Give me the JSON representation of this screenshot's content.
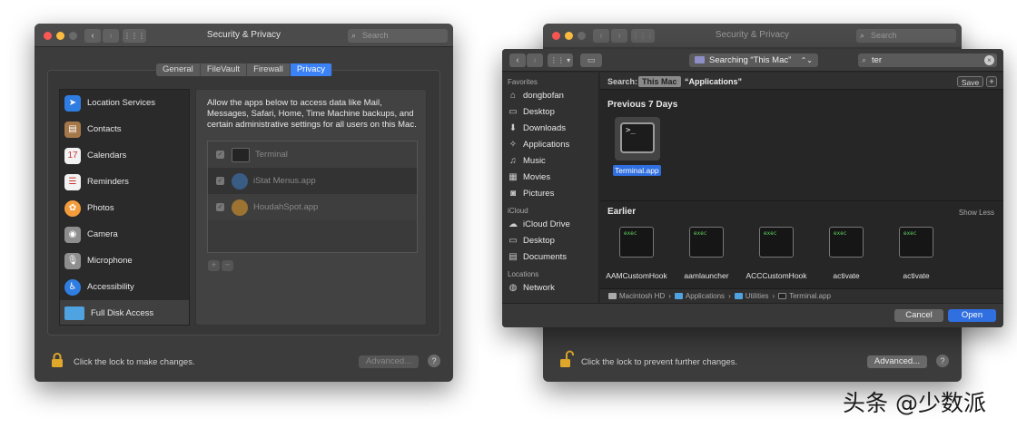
{
  "left_window": {
    "title": "Security & Privacy",
    "search_placeholder": "Search",
    "nav_back": "‹",
    "nav_forward": "›",
    "tabs": [
      {
        "label": "General",
        "selected": false
      },
      {
        "label": "FileVault",
        "selected": false
      },
      {
        "label": "Firewall",
        "selected": false
      },
      {
        "label": "Privacy",
        "selected": true
      }
    ],
    "sidebar": [
      {
        "label": "Location Services",
        "icon": "location-arrow-icon",
        "color": "#2f7de1"
      },
      {
        "label": "Contacts",
        "icon": "contacts-book-icon",
        "color": "#a5784a"
      },
      {
        "label": "Calendars",
        "icon": "calendar-icon",
        "color": "#f2f2f2"
      },
      {
        "label": "Reminders",
        "icon": "reminders-list-icon",
        "color": "#f2f2f2"
      },
      {
        "label": "Photos",
        "icon": "photos-flower-icon",
        "color": "#f39c3c"
      },
      {
        "label": "Camera",
        "icon": "camera-icon",
        "color": "#8e8e8e"
      },
      {
        "label": "Microphone",
        "icon": "microphone-icon",
        "color": "#8e8e8e"
      },
      {
        "label": "Accessibility",
        "icon": "accessibility-person-icon",
        "color": "#2f7de1"
      },
      {
        "label": "Full Disk Access",
        "icon": "folder-icon",
        "color": "#4fa3e0",
        "selected": true
      }
    ],
    "description": "Allow the apps below to access data like Mail, Messages, Safari, Home, Time Machine backups, and certain administrative settings for all users on this Mac.",
    "apps": [
      {
        "label": "Terminal",
        "icon": "terminal-icon"
      },
      {
        "label": "iStat Menus.app",
        "icon": "istat-menus-icon"
      },
      {
        "label": "HoudahSpot.app",
        "icon": "houdahspot-icon"
      }
    ],
    "add_label": "+",
    "remove_label": "−",
    "lock_text": "Click the lock to make changes.",
    "advanced_label": "Advanced...",
    "help_label": "?"
  },
  "right_window": {
    "back_title": "Security & Privacy",
    "search_placeholder": "Search",
    "lock_text": "Click the lock to prevent further changes.",
    "advanced_label": "Advanced...",
    "help_label": "?",
    "dialog": {
      "location_label": "Searching “This Mac”",
      "search_value": "ter",
      "search_row": {
        "label": "Search:",
        "scope_selected": "This Mac",
        "scope_other": "“Applications”",
        "save_label": "Save",
        "add_label": "+"
      },
      "sidebar_sections": [
        {
          "header": "Favorites",
          "items": [
            {
              "label": "dongbofan",
              "icon": "home-icon"
            },
            {
              "label": "Desktop",
              "icon": "desktop-icon"
            },
            {
              "label": "Downloads",
              "icon": "downloads-icon"
            },
            {
              "label": "Applications",
              "icon": "applications-icon"
            },
            {
              "label": "Music",
              "icon": "music-note-icon"
            },
            {
              "label": "Movies",
              "icon": "movies-film-icon"
            },
            {
              "label": "Pictures",
              "icon": "pictures-camera-icon"
            }
          ]
        },
        {
          "header": "iCloud",
          "items": [
            {
              "label": "iCloud Drive",
              "icon": "cloud-icon"
            },
            {
              "label": "Desktop",
              "icon": "desktop-icon"
            },
            {
              "label": "Documents",
              "icon": "documents-icon"
            }
          ]
        },
        {
          "header": "Locations",
          "items": [
            {
              "label": "Network",
              "icon": "network-globe-icon"
            }
          ]
        }
      ],
      "recent_header": "Previous 7 Days",
      "recent_file": {
        "label": "Terminal.app",
        "glyph": ">_"
      },
      "earlier_header": "Earlier",
      "show_less": "Show Less",
      "earlier_files": [
        {
          "label": "AAMCustomHook",
          "badge": "exec"
        },
        {
          "label": "aamlauncher",
          "badge": "exec"
        },
        {
          "label": "ACCCustomHook",
          "badge": "exec"
        },
        {
          "label": "activate",
          "badge": "exec"
        },
        {
          "label": "activate",
          "badge": "exec"
        }
      ],
      "path": [
        "Macintosh HD",
        "Applications",
        "Utilities",
        "Terminal.app"
      ],
      "path_sep": "›",
      "cancel_label": "Cancel",
      "open_label": "Open"
    }
  },
  "watermark": "头条 @少数派",
  "colors": {
    "accent": "#2f6fe0",
    "window_bg": "#3a3a3a",
    "titlebar": "#4a4a4a"
  }
}
